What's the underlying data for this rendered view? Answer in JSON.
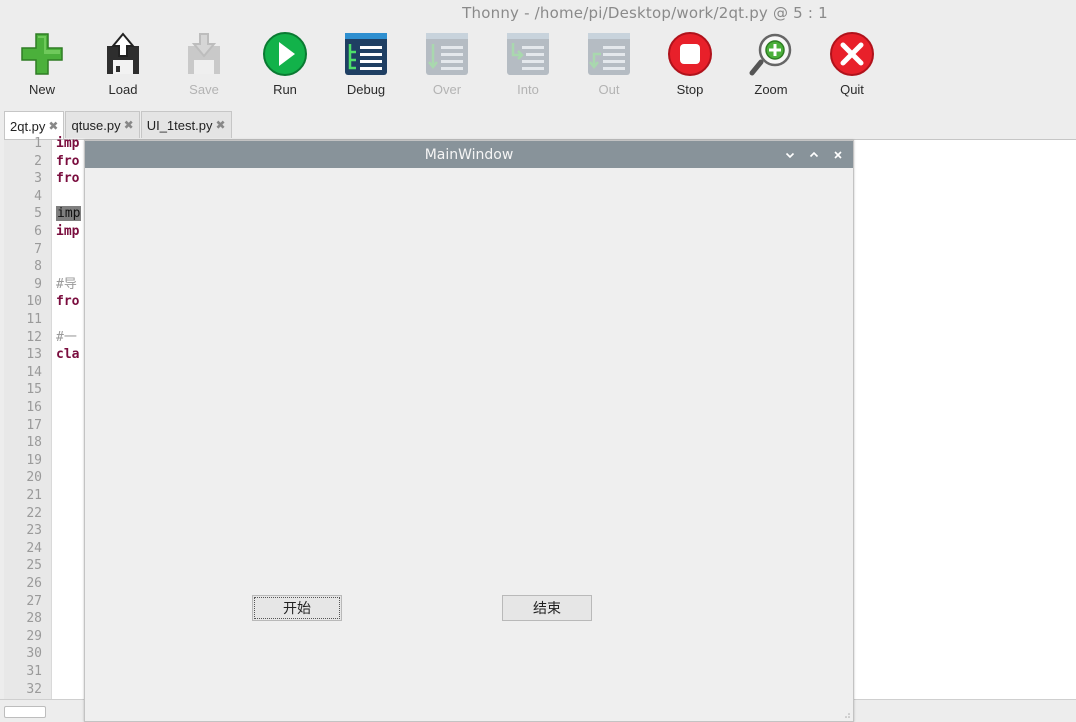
{
  "window": {
    "title": "Thonny  -  /home/pi/Desktop/work/2qt.py  @  5 : 1"
  },
  "toolbar": {
    "buttons": [
      {
        "label": "New",
        "icon": "new-icon",
        "enabled": true
      },
      {
        "label": "Load",
        "icon": "load-icon",
        "enabled": true
      },
      {
        "label": "Save",
        "icon": "save-icon",
        "enabled": false
      },
      {
        "label": "Run",
        "icon": "run-icon",
        "enabled": true
      },
      {
        "label": "Debug",
        "icon": "debug-icon",
        "enabled": true
      },
      {
        "label": "Over",
        "icon": "step-over-icon",
        "enabled": false
      },
      {
        "label": "Into",
        "icon": "step-into-icon",
        "enabled": false
      },
      {
        "label": "Out",
        "icon": "step-out-icon",
        "enabled": false
      },
      {
        "label": "Stop",
        "icon": "stop-icon",
        "enabled": true
      },
      {
        "label": "Zoom",
        "icon": "zoom-icon",
        "enabled": true
      },
      {
        "label": "Quit",
        "icon": "quit-icon",
        "enabled": true
      }
    ]
  },
  "tabs": [
    {
      "label": "2qt.py",
      "close": "✖",
      "active": true
    },
    {
      "label": "qtuse.py",
      "close": "✖",
      "active": false
    },
    {
      "label": "UI_1test.py",
      "close": "✖",
      "active": false
    }
  ],
  "editor": {
    "line_numbers": [
      "1",
      "2",
      "3",
      "4",
      "5",
      "6",
      "7",
      "8",
      "9",
      "10",
      "11",
      "12",
      "13",
      "14",
      "15",
      "16",
      "17",
      "18",
      "19",
      "20",
      "21",
      "22",
      "23",
      "24",
      "25",
      "26",
      "27",
      "28",
      "29",
      "30",
      "31",
      "32"
    ],
    "code_lines": [
      {
        "line": "1",
        "text": "imp",
        "style": "kw"
      },
      {
        "line": "2",
        "text": "fro",
        "style": "kw"
      },
      {
        "line": "3",
        "text": "fro",
        "style": "kw"
      },
      {
        "line": "5",
        "text": "imp",
        "style": "hl"
      },
      {
        "line": "6",
        "text": "imp",
        "style": "kw"
      },
      {
        "line": "9",
        "text": "#导",
        "style": "cm"
      },
      {
        "line": "10",
        "text": "fro",
        "style": "kw"
      },
      {
        "line": "12",
        "text": "#一",
        "style": "cm"
      },
      {
        "line": "13",
        "text": "cla",
        "style": "kw"
      }
    ]
  },
  "qt_window": {
    "title": "MainWindow",
    "start_button": "开始",
    "end_button": "结束"
  },
  "colors": {
    "accent_green": "#3cb371",
    "stop_red": "#e8202a",
    "titlebar": "#88939a"
  }
}
